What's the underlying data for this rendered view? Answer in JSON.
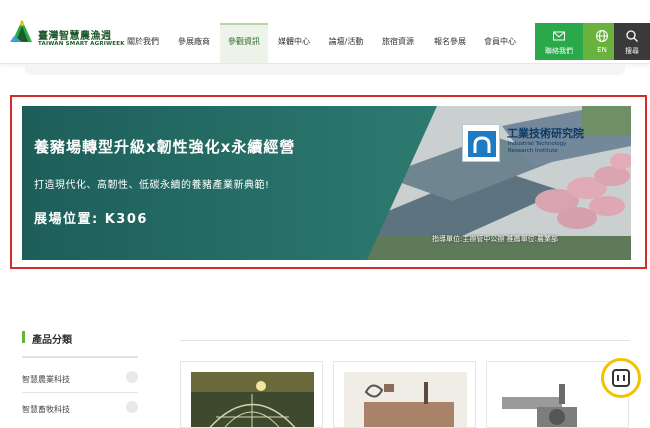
{
  "header": {
    "logo": {
      "name_cn": "臺灣智慧農漁週",
      "name_en": "TAIWAN SMART AGRIWEEK"
    },
    "nav": [
      {
        "label": "關於我們",
        "active": false
      },
      {
        "label": "參展廠商",
        "active": false
      },
      {
        "label": "參觀資訊",
        "active": true
      },
      {
        "label": "媒體中心",
        "active": false
      },
      {
        "label": "論壇/活動",
        "active": false
      },
      {
        "label": "旅宿資源",
        "active": false
      },
      {
        "label": "報名參展",
        "active": false
      },
      {
        "label": "會員中心",
        "active": false
      }
    ],
    "actions": {
      "contact": {
        "label": "聯絡我們",
        "icon": "mail-icon"
      },
      "language": {
        "label": "EN",
        "icon": "globe-icon"
      },
      "search": {
        "label": "搜尋",
        "icon": "search-icon"
      }
    }
  },
  "banner": {
    "title": "養豬場轉型升級x韌性強化x永續經營",
    "subtitle": "打造現代化、高韌性、低碳永續的養豬產業新典範!",
    "booth": "展場位置: K306",
    "org_cn": "工業技術研究院",
    "org_en_line1": "Industrial Technology",
    "org_en_line2": "Research Institute",
    "credit": "指導單位:主辦管中公辦 推薦單位:農業部",
    "highlight_color": "#d52b2b"
  },
  "sidebar": {
    "title": "產品分類",
    "items": [
      {
        "label": "智慧農業科技"
      },
      {
        "label": "智慧畜牧科技"
      }
    ]
  },
  "colors": {
    "brand_green": "#2aa84a",
    "lang_green": "#6ab23e",
    "search_dark": "#3a3a3a",
    "float_button_ring": "#f2c200"
  }
}
